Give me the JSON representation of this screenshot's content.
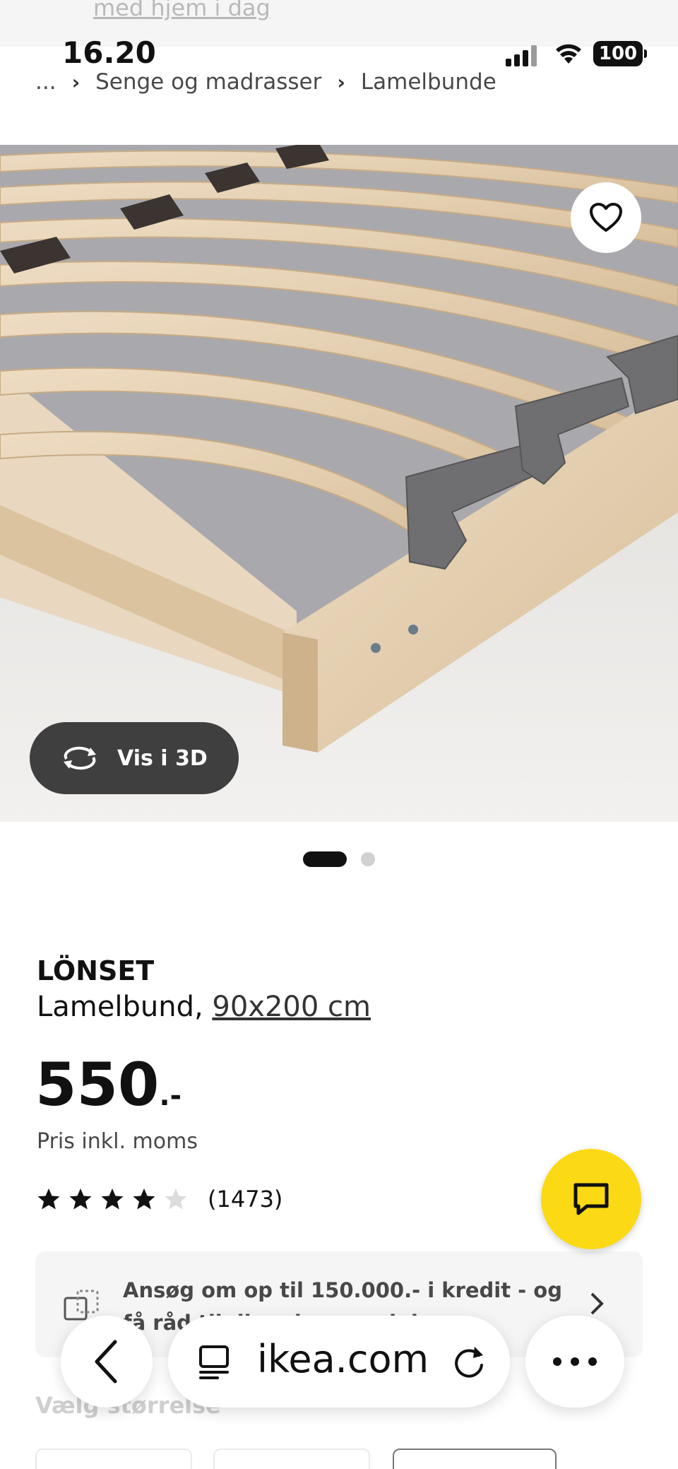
{
  "banner": {
    "text": "med hjem i dag"
  },
  "status_bar": {
    "time": "16.20",
    "battery": "100"
  },
  "breadcrumb": {
    "ellipsis": "...",
    "items": [
      "Senge og madrasser",
      "Lamelbunde"
    ]
  },
  "gallery": {
    "view_3d_label": "Vis i 3D",
    "image_count": 2,
    "active_index": 0
  },
  "product": {
    "name": "LÖNSET",
    "type": "Lamelbund,",
    "size": "90x200 cm",
    "price": "550",
    "price_suffix": ".-",
    "price_note": "Pris inkl. moms",
    "rating": 4,
    "rating_max": 5,
    "review_count": "(1473)"
  },
  "credit": {
    "text": "Ansøg om op til 150.000.- i kredit - og få råd til dine drømme i dag"
  },
  "size_section": {
    "label": "Vælg størrelse"
  },
  "browser": {
    "url": "ikea.com"
  },
  "colors": {
    "chat_yellow": "#fbd914",
    "dark_button": "#3f3f3f"
  }
}
